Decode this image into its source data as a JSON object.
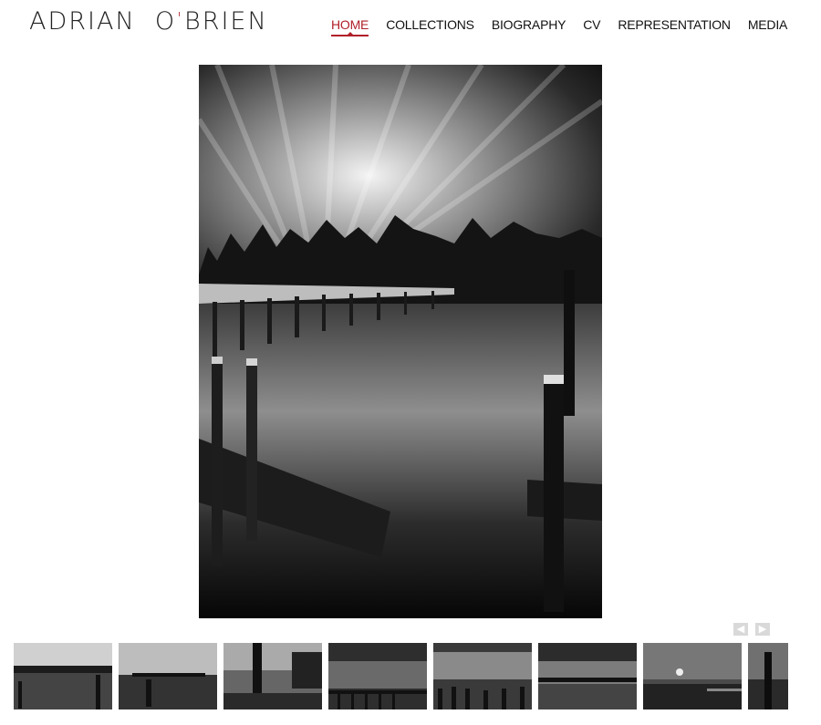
{
  "site": {
    "logo_first": "ADRIAN",
    "logo_mark": "'",
    "logo_last": "O BRIEN"
  },
  "nav": {
    "items": [
      "HOME",
      "COLLECTIONS",
      "BIOGRAPHY",
      "CV",
      "REPRESENTATION",
      "MEDIA"
    ],
    "active": "HOME"
  },
  "gallery": {
    "prev_icon": "chevron-left-icon",
    "next_icon": "chevron-right-icon",
    "thumbnail_count": 8,
    "colors": {
      "accent": "#b0202a",
      "pager": "#d9d9d9"
    }
  }
}
